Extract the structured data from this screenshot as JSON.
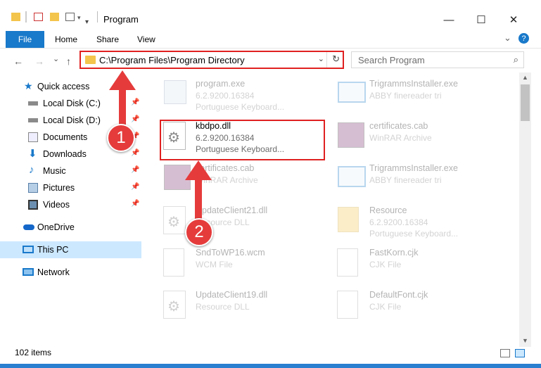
{
  "window": {
    "title": "Program",
    "minimize": "—",
    "maximize": "☐",
    "close": "✕"
  },
  "ribbon": {
    "file": "File",
    "home": "Home",
    "share": "Share",
    "view": "View",
    "collapse": "⌄",
    "help": "?"
  },
  "nav": {
    "back": "←",
    "forward": "→",
    "recent": "⌄",
    "up": "↑"
  },
  "address": {
    "path": "C:\\Program Files\\Program Directory",
    "dropdown": "⌄",
    "refresh": "↻"
  },
  "search": {
    "placeholder": "Search Program",
    "icon": "⌕"
  },
  "sidebar": {
    "items": [
      {
        "label": "Quick access",
        "icon": "star-icon"
      },
      {
        "label": "Local Disk (C:)",
        "icon": "drive-icon",
        "pinned": true
      },
      {
        "label": "Local Disk (D:)",
        "icon": "drive-icon",
        "pinned": true
      },
      {
        "label": "Documents",
        "icon": "documents-icon",
        "pinned": true
      },
      {
        "label": "Downloads",
        "icon": "download-arrow-icon",
        "pinned": true
      },
      {
        "label": "Music",
        "icon": "music-note-icon",
        "pinned": true
      },
      {
        "label": "Pictures",
        "icon": "pictures-icon",
        "pinned": true
      },
      {
        "label": "Videos",
        "icon": "film-icon",
        "pinned": true
      },
      {
        "label": "OneDrive",
        "icon": "cloud-icon"
      },
      {
        "label": "This PC",
        "icon": "monitor-icon",
        "selected": true
      },
      {
        "label": "Network",
        "icon": "network-icon"
      }
    ],
    "pin_glyph": "📌"
  },
  "files": [
    {
      "name": "program.exe",
      "line2": "6.2.9200.16384",
      "line3": "Portuguese Keyboard...",
      "icon": "exe-icon"
    },
    {
      "name": "TrigrammsInstaller.exe",
      "line2": "ABBY finereader tri",
      "line3": "",
      "icon": "window-app-icon"
    },
    {
      "name": "kbdpo.dll",
      "line2": "6.2.9200.16384",
      "line3": "Portuguese Keyboard...",
      "icon": "dll-gear-icon",
      "highlighted": true
    },
    {
      "name": "certificates.cab",
      "line2": "WinRAR Archive",
      "line3": "",
      "icon": "winrar-icon"
    },
    {
      "name": "certificates.cab",
      "line2": "WinRAR Archive",
      "line3": "",
      "icon": "winrar-icon"
    },
    {
      "name": "TrigrammsInstaller.exe",
      "line2": "ABBY finereader tri",
      "line3": "",
      "icon": "window-app-icon"
    },
    {
      "name": "UpdateClient21.dll",
      "line2": "Resource DLL",
      "line3": "",
      "icon": "dll-gear-icon"
    },
    {
      "name": "Resource",
      "line2": "6.2.9200.16384",
      "line3": "Portuguese Keyboard...",
      "icon": "folder-icon"
    },
    {
      "name": "SndToWP16.wcm",
      "line2": "WCM File",
      "line3": "",
      "icon": "blank-file-icon"
    },
    {
      "name": "FastKorn.cjk",
      "line2": "CJK File",
      "line3": "",
      "icon": "blank-file-icon"
    },
    {
      "name": "UpdateClient19.dll",
      "line2": "Resource DLL",
      "line3": "",
      "icon": "dll-gear-icon"
    },
    {
      "name": "DefaultFont.cjk",
      "line2": "CJK File",
      "line3": "",
      "icon": "blank-file-icon"
    }
  ],
  "status": {
    "items": "102 items"
  },
  "callouts": {
    "one": "1",
    "two": "2"
  },
  "colors": {
    "accent": "#1979ca",
    "highlight": "#e02020",
    "callout": "#e53b3b",
    "selected": "#cce8ff"
  }
}
